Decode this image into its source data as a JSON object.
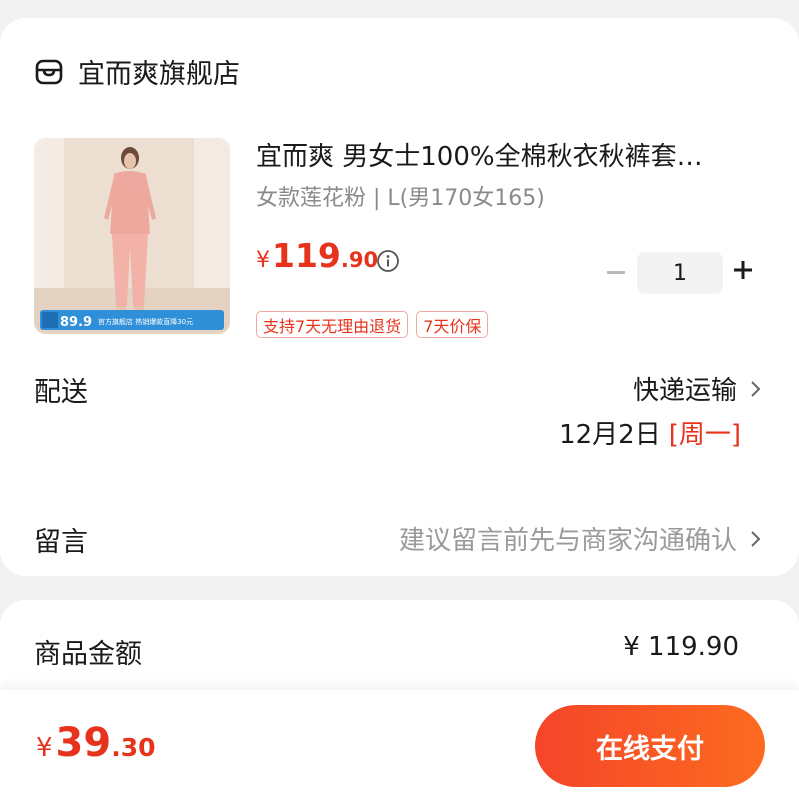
{
  "shop": {
    "name": "宜而爽旗舰店",
    "icon": "store-icon"
  },
  "product": {
    "title": "宜而爽 男女士100%全棉秋衣秋裤套…",
    "variant": "女款莲花粉 | L(男170女165)",
    "price": {
      "currency": "¥",
      "integer": "119",
      "decimal": ".90"
    },
    "image": {
      "badge_price": "89.9",
      "badge_small": "到手\n价",
      "badge_text": "官方旗舰店 热销爆款直降30元"
    },
    "quantity": "1",
    "tags": [
      "支持7天无理由退货",
      "7天价保"
    ]
  },
  "delivery": {
    "label": "配送",
    "method": "快递运输",
    "date": "12月2日",
    "weekday": "[周一]"
  },
  "note": {
    "label": "留言",
    "placeholder": "建议留言前先与商家沟通确认"
  },
  "summary": {
    "amount_label": "商品金额",
    "amount_value": "¥ 119.90"
  },
  "checkout": {
    "total": {
      "currency": "¥",
      "integer": "39",
      "decimal": ".30"
    },
    "pay_label": "在线支付"
  },
  "colors": {
    "accent": "#e8331c",
    "pay_gradient_start": "#f5452a",
    "pay_gradient_end": "#fc6b1f",
    "tag_border": "#f0a8a0"
  }
}
